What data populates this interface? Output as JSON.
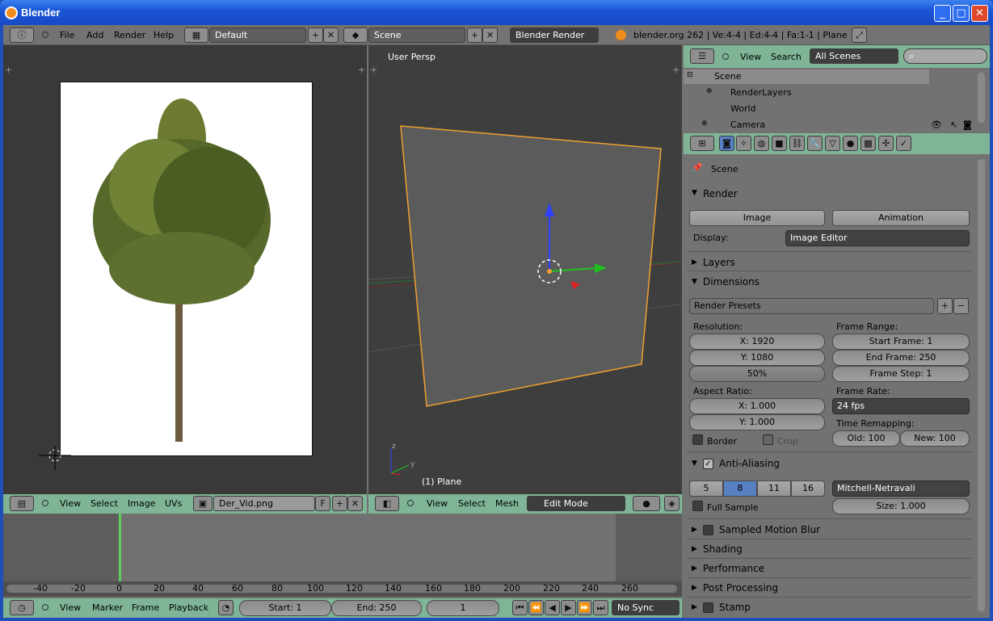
{
  "window": {
    "title": "Blender"
  },
  "info_header": {
    "menus": [
      "File",
      "Add",
      "Render",
      "Help"
    ],
    "screen_layout": "Default",
    "scene": "Scene",
    "render_engine": "Blender Render",
    "stats": "blender.org 262 | Ve:4-4 | Ed:4-4 | Fa:1-1 | Plane"
  },
  "image_editor": {
    "menus": [
      "View",
      "Select",
      "Image",
      "UVs"
    ],
    "image_name": "Der_Vid.png",
    "fake_user": "F"
  },
  "view3d": {
    "label": "User Persp",
    "object_label": "(1) Plane",
    "menus": [
      "View",
      "Select",
      "Mesh"
    ],
    "mode": "Edit Mode",
    "axis_z": "z",
    "axis_y": "y"
  },
  "timeline": {
    "ruler": [
      "-40",
      "-20",
      "0",
      "20",
      "40",
      "60",
      "80",
      "100",
      "120",
      "140",
      "160",
      "180",
      "200",
      "220",
      "240",
      "260"
    ],
    "menus": [
      "View",
      "Marker",
      "Frame",
      "Playback"
    ],
    "start": "Start: 1",
    "end": "End: 250",
    "current": "1",
    "sync": "No Sync"
  },
  "outliner": {
    "menus": [
      "View",
      "Search"
    ],
    "filter": "All Scenes",
    "items": [
      "Scene",
      "RenderLayers",
      "World",
      "Camera"
    ]
  },
  "properties": {
    "context": "Scene",
    "render": {
      "title": "Render",
      "image_btn": "Image",
      "animation_btn": "Animation",
      "display_label": "Display:",
      "display_value": "Image Editor"
    },
    "layers_title": "Layers",
    "dimensions": {
      "title": "Dimensions",
      "presets": "Render Presets",
      "resolution_label": "Resolution:",
      "res_x": "X: 1920",
      "res_y": "Y: 1080",
      "res_pct": "50%",
      "frame_range_label": "Frame Range:",
      "start_frame": "Start Frame: 1",
      "end_frame": "End Frame: 250",
      "frame_step": "Frame Step: 1",
      "aspect_label": "Aspect Ratio:",
      "asp_x": "X: 1.000",
      "asp_y": "Y: 1.000",
      "frame_rate_label": "Frame Rate:",
      "frame_rate": "24 fps",
      "border": "Border",
      "crop": "Crop",
      "time_remap_label": "Time Remapping:",
      "old": "Old: 100",
      "new": "New: 100"
    },
    "aa": {
      "title": "Anti-Aliasing",
      "samples": [
        "5",
        "8",
        "11",
        "16"
      ],
      "filter": "Mitchell-Netravali",
      "full_sample": "Full Sample",
      "size": "Size: 1.000"
    },
    "panels": [
      "Sampled Motion Blur",
      "Shading",
      "Performance",
      "Post Processing",
      "Stamp"
    ]
  },
  "colors": {
    "selection": "#5680c2",
    "header_green": "#7fb596",
    "edit_orange": "#f0a030"
  }
}
